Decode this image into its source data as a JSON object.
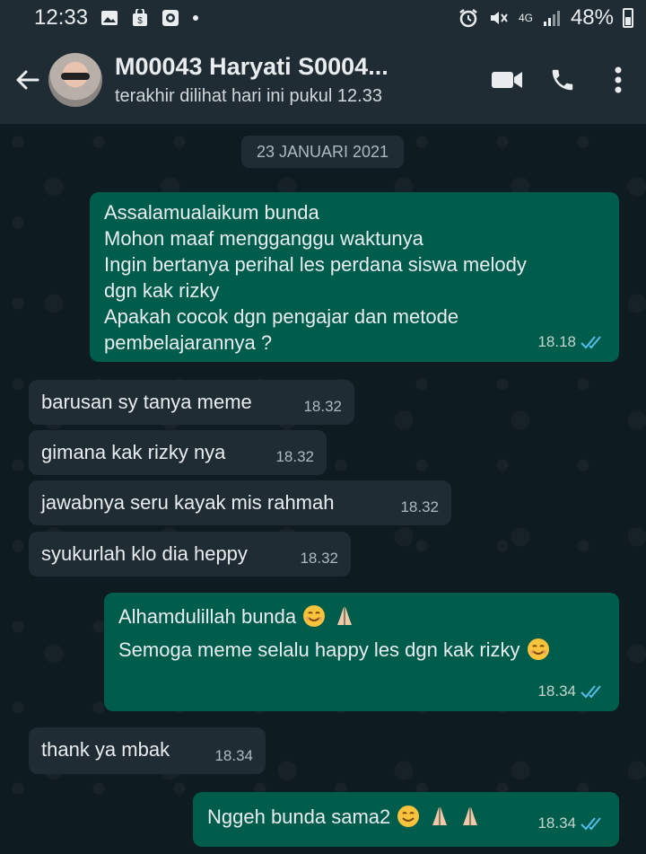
{
  "status_bar": {
    "time": "12:33",
    "network": "4G",
    "battery": "48%",
    "battery_level": 0.48
  },
  "header": {
    "contact_name": "M00043 Haryati S0004...",
    "last_seen": "terakhir dilihat hari ini pukul 12.33",
    "icons": [
      "back-arrow-icon",
      "video-call-icon",
      "phone-icon",
      "more-vert-icon"
    ]
  },
  "chat": {
    "date_label": "23 JANUARI 2021",
    "messages": [
      {
        "direction": "out",
        "lines": [
          "Assalamualaikum bunda",
          "Mohon maaf mengganggu waktunya",
          "Ingin bertanya perihal les perdana siswa melody",
          "dgn kak rizky",
          "Apakah cocok dgn pengajar dan metode",
          "pembelajarannya ?"
        ],
        "time": "18.18",
        "read": true
      },
      {
        "direction": "in",
        "text": "barusan sy tanya meme",
        "time": "18.32"
      },
      {
        "direction": "in",
        "text": "gimana kak rizky nya",
        "time": "18.32"
      },
      {
        "direction": "in",
        "text": "jawabnya seru kayak mis rahmah",
        "time": "18.32"
      },
      {
        "direction": "in",
        "text": "syukurlah klo dia heppy",
        "time": "18.32"
      },
      {
        "direction": "out",
        "lines": [
          "Alhamdulillah bunda",
          "Semoga meme selalu happy les dgn kak rizky"
        ],
        "time": "18.34",
        "read": true
      },
      {
        "direction": "in",
        "text": "thank ya mbak",
        "time": "18.34"
      },
      {
        "direction": "out",
        "text": "Nggeh bunda sama2",
        "time": "18.34",
        "read": true
      }
    ]
  },
  "colors": {
    "outgoing_bubble": "#005c4b",
    "incoming_bubble": "#1f2c33",
    "header": "#1f2c33",
    "read_ticks": "#53bdeb"
  }
}
